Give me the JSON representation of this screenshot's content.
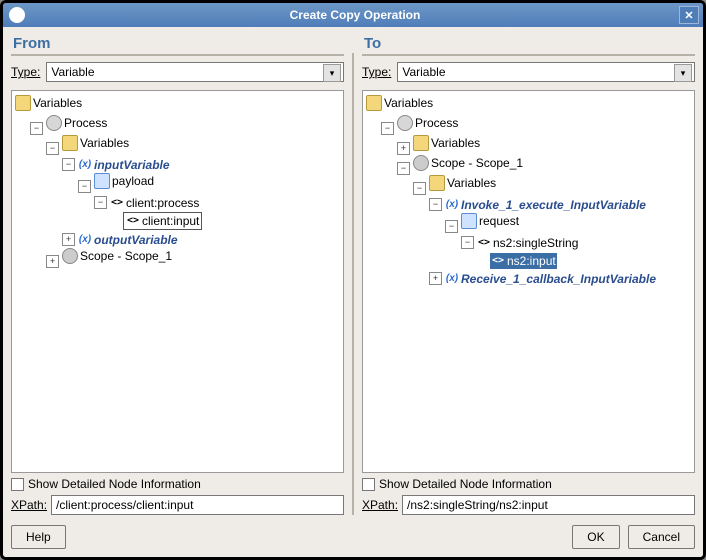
{
  "title": "Create Copy Operation",
  "from": {
    "heading": "From",
    "type_label": "Type:",
    "type_value": "Variable",
    "show_detail_label": "Show Detailed Node Information",
    "xpath_label": "XPath:",
    "xpath_value": "/client:process/client:input",
    "tree": {
      "root": "Variables",
      "process": "Process",
      "variables": "Variables",
      "inputVariable": "inputVariable",
      "payload": "payload",
      "clientprocess": "client:process",
      "clientinput": "client:input",
      "outputVariable": "outputVariable",
      "scope": "Scope - Scope_1"
    }
  },
  "to": {
    "heading": "To",
    "type_label": "Type:",
    "type_value": "Variable",
    "show_detail_label": "Show Detailed Node Information",
    "xpath_label": "XPath:",
    "xpath_value": "/ns2:singleString/ns2:input",
    "tree": {
      "root": "Variables",
      "process": "Process",
      "variables": "Variables",
      "scope": "Scope - Scope_1",
      "variables2": "Variables",
      "invoke": "Invoke_1_execute_InputVariable",
      "request": "request",
      "singleString": "ns2:singleString",
      "ns2input": "ns2:input",
      "receive": "Receive_1_callback_InputVariable"
    }
  },
  "buttons": {
    "help": "Help",
    "ok": "OK",
    "cancel": "Cancel"
  }
}
